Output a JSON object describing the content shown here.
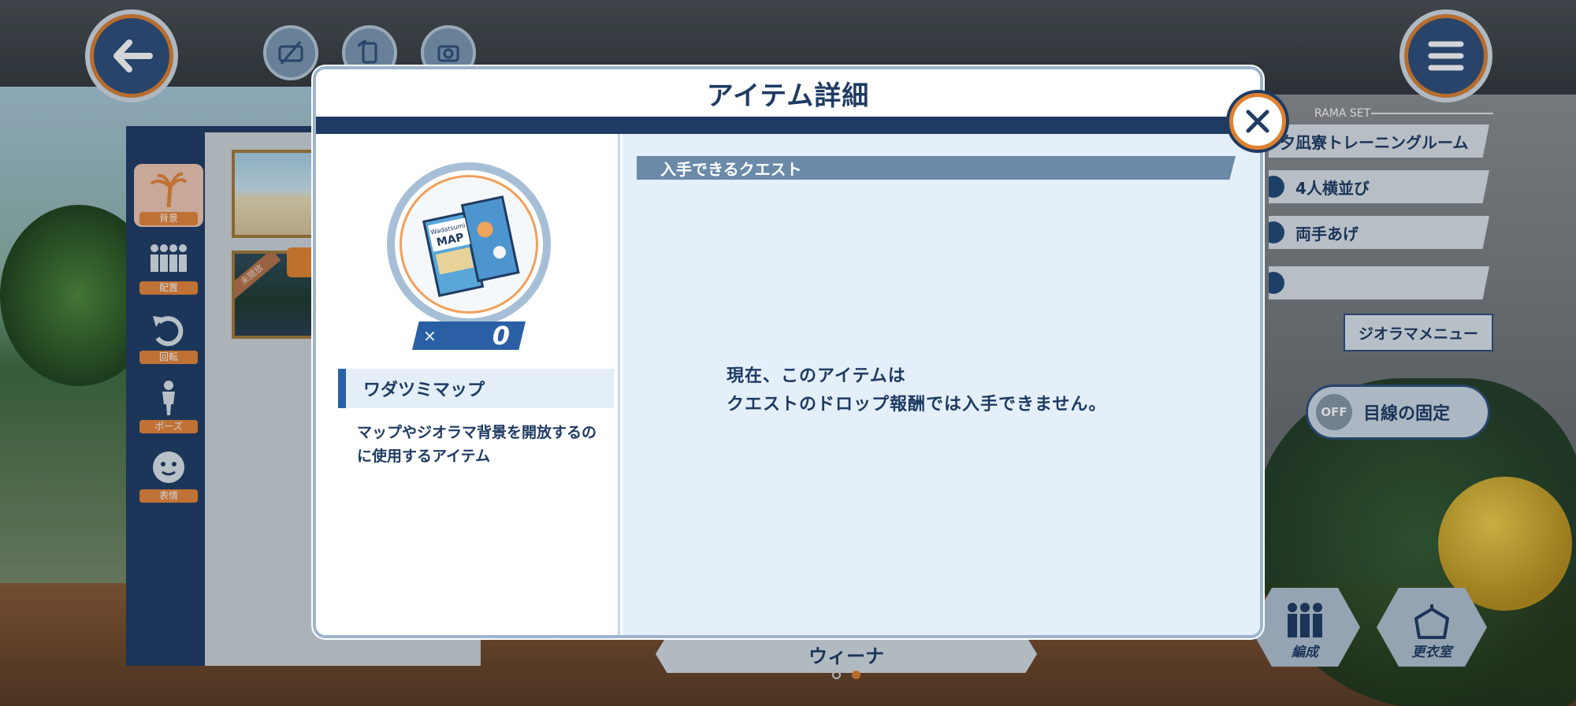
{
  "top_controls": {
    "back_icon": "arrow-left-icon",
    "camera_hide_icon": "hide-ui-icon",
    "camera_rotate_icon": "rotate-screen-icon",
    "camera_switch_icon": "camera-switch-icon",
    "menu_icon": "hamburger-menu-icon"
  },
  "editor_tools": [
    {
      "label": "背景",
      "icon": "palm-tree-icon"
    },
    {
      "label": "配置",
      "icon": "people-group-icon"
    },
    {
      "label": "回転",
      "icon": "rotate-icon"
    },
    {
      "label": "ポーズ",
      "icon": "pose-figure-icon"
    },
    {
      "label": "表情",
      "icon": "face-icon"
    }
  ],
  "thumbnails": {
    "locked_banner": "未開放"
  },
  "diorama": {
    "set_title": "RAMA SET",
    "rows": [
      {
        "label": "夕凪寮トレーニングルーム"
      },
      {
        "label": "4人横並び"
      },
      {
        "label": "両手あげ"
      },
      {
        "label": ""
      }
    ],
    "menu_button": "ジオラマメニュー",
    "gaze_toggle_state": "OFF",
    "gaze_toggle_label": "目線の固定",
    "formation_button": "編成",
    "wardrobe_button": "更衣室"
  },
  "character_bar": {
    "name": "ウィーナ",
    "page_count": 2,
    "current_page": 2
  },
  "modal": {
    "title": "アイテム詳細",
    "item": {
      "icon": "wadatsumi-map-icon",
      "icon_text_line1": "Wadatsumi",
      "icon_text_line2": "MAP",
      "quantity_prefix": "×",
      "quantity": "0",
      "name": "ワダツミマップ",
      "description": "マップやジオラマ背景を開放するのに使用するアイテム"
    },
    "quest_section_header": "入手できるクエスト",
    "no_quest_line1": "現在、このアイテムは",
    "no_quest_line2": "クエストのドロップ報酬では入手できません。",
    "close_icon": "close-x-icon"
  },
  "colors": {
    "navy": "#1f3b63",
    "accent_orange": "#e0812f",
    "panel_light_blue": "#e4effa",
    "quantity_blue": "#2a5fa6"
  }
}
